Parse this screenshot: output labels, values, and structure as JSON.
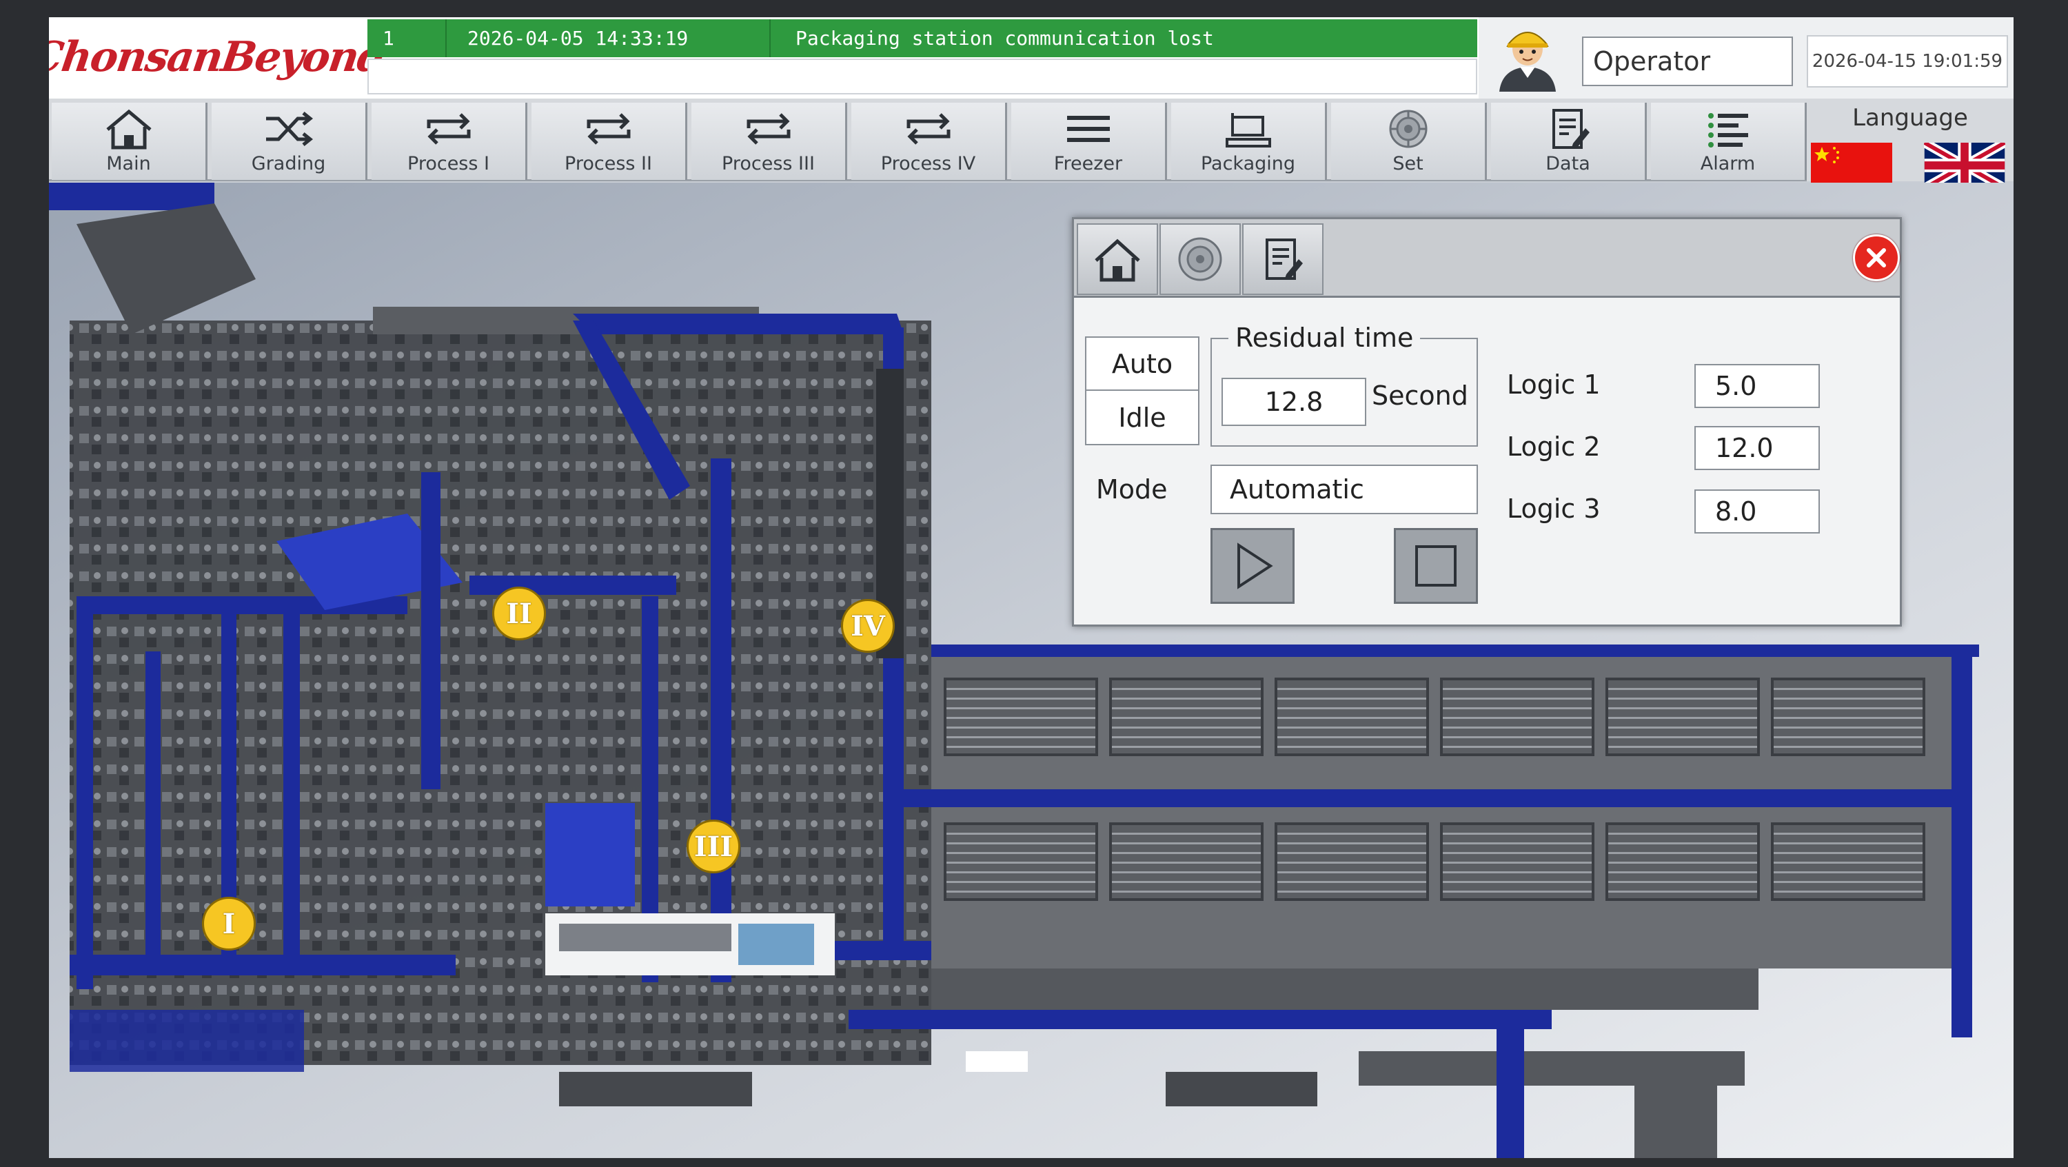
{
  "brand": {
    "logo_text": "ChonsanBeyond"
  },
  "alarm": {
    "index": "1",
    "timestamp": "2026-04-05  14:33:19",
    "message": "Packaging station communication lost"
  },
  "operator": {
    "name": "Operator",
    "datetime": "2026-04-15 19:01:59"
  },
  "nav": {
    "items": [
      {
        "label": "Main",
        "icon": "home-icon"
      },
      {
        "label": "Grading",
        "icon": "shuffle-icon"
      },
      {
        "label": "Process I",
        "icon": "repeat-icon"
      },
      {
        "label": "Process II",
        "icon": "repeat-icon"
      },
      {
        "label": "Process III",
        "icon": "repeat-icon"
      },
      {
        "label": "Process IV",
        "icon": "repeat-icon"
      },
      {
        "label": "Freezer",
        "icon": "menu-icon"
      },
      {
        "label": "Packaging",
        "icon": "package-icon"
      },
      {
        "label": "Set",
        "icon": "gear-icon"
      },
      {
        "label": "Data",
        "icon": "document-icon"
      },
      {
        "label": "Alarm",
        "icon": "list-alarm-icon"
      }
    ]
  },
  "language": {
    "label": "Language",
    "options": [
      "cn-flag",
      "uk-flag"
    ]
  },
  "scene": {
    "markers": [
      "I",
      "II",
      "III",
      "IV"
    ]
  },
  "dialog": {
    "state_top": "Auto",
    "state_bottom": "Idle",
    "residual": {
      "title": "Residual time",
      "value": "12.8",
      "unit": "Second"
    },
    "mode": {
      "label": "Mode",
      "value": "Automatic"
    },
    "logic": [
      {
        "label": "Logic 1",
        "value": "5.0"
      },
      {
        "label": "Logic 2",
        "value": "12.0"
      },
      {
        "label": "Logic 3",
        "value": "8.0"
      }
    ]
  },
  "colors": {
    "accent_green": "#2e9a3f",
    "close_red": "#e5271f",
    "marker_yellow": "#f6c623",
    "conveyor_blue": "#1c2b9c"
  }
}
